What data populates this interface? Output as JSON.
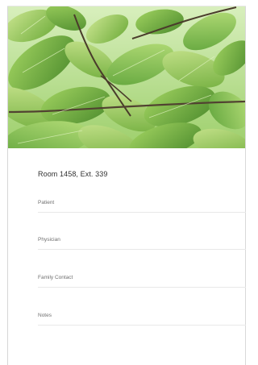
{
  "room": {
    "title": "Room 1458, Ext. 339"
  },
  "fields": [
    {
      "label": "Patient"
    },
    {
      "label": "Physician"
    },
    {
      "label": "Family Contact"
    },
    {
      "label": "Notes"
    }
  ]
}
